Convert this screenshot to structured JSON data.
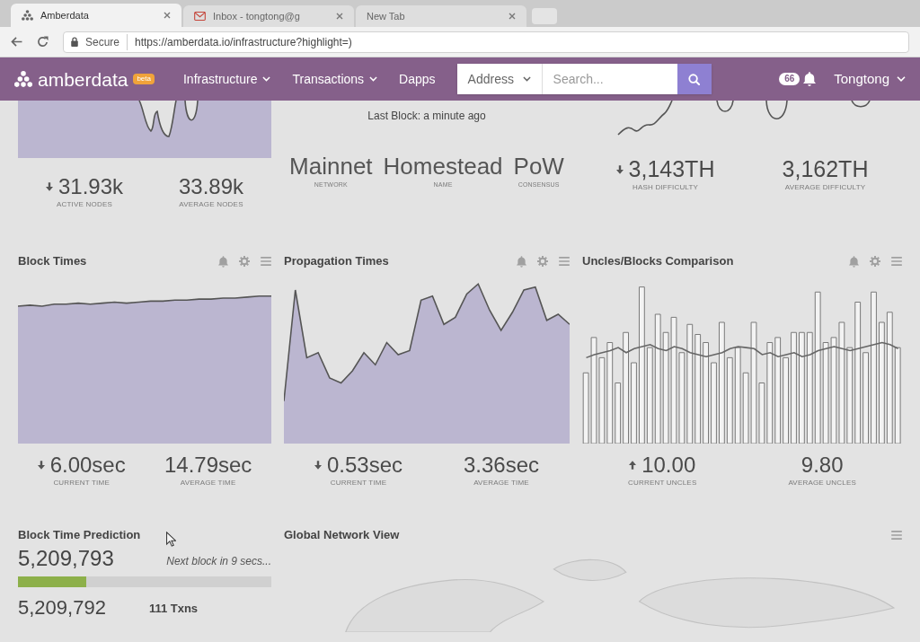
{
  "browser": {
    "tabs": [
      {
        "title": "Amberdata",
        "selected": true
      },
      {
        "title": "Inbox - tongtong@g",
        "selected": false
      },
      {
        "title": "New Tab",
        "selected": false
      }
    ],
    "secure_label": "Secure",
    "url": "https://amberdata.io/infrastructure?highlight=)"
  },
  "header": {
    "logo": "amberdata",
    "badge": "beta",
    "nav": [
      {
        "label": "Infrastructure",
        "dropdown": true
      },
      {
        "label": "Transactions",
        "dropdown": true
      },
      {
        "label": "Dapps",
        "dropdown": false
      }
    ],
    "search": {
      "type": "Address",
      "placeholder": "Search..."
    },
    "notifications": "66",
    "user": "Tongtong"
  },
  "overview": {
    "nodes": [
      {
        "value": "31.93k",
        "label": "ACTIVE NODES",
        "kind": "falling"
      },
      {
        "value": "33.89k",
        "label": "AVERAGE NODES",
        "kind": "plain"
      }
    ],
    "last_block": "Last Block: a minute ago",
    "network": [
      {
        "value": "Mainnet",
        "label": "NETWORK"
      },
      {
        "value": "Homestead",
        "label": "NAME"
      },
      {
        "value": "PoW",
        "label": "CONSENSUS"
      }
    ],
    "difficulty": [
      {
        "value": "3,143TH",
        "label": "HASH DIFFICULTY",
        "kind": "falling"
      },
      {
        "value": "3,162TH",
        "label": "AVERAGE DIFFICULTY",
        "kind": "plain"
      }
    ]
  },
  "panels": [
    {
      "title": "Block Times",
      "kind": "area",
      "stats": [
        {
          "value": "6.00sec",
          "label": "CURRENT TIME",
          "kind": "falling"
        },
        {
          "value": "14.79sec",
          "label": "AVERAGE TIME",
          "kind": "plain"
        }
      ]
    },
    {
      "title": "Propagation Times",
      "kind": "area",
      "stats": [
        {
          "value": "0.53sec",
          "label": "CURRENT TIME",
          "kind": "falling"
        },
        {
          "value": "3.36sec",
          "label": "AVERAGE TIME",
          "kind": "plain"
        }
      ]
    },
    {
      "title": "Uncles/Blocks Comparison",
      "kind": "bars",
      "stats": [
        {
          "value": "10.00",
          "label": "CURRENT UNCLES",
          "kind": "rising"
        },
        {
          "value": "9.80",
          "label": "AVERAGE UNCLES",
          "kind": "plain"
        }
      ]
    }
  ],
  "prediction": {
    "title": "Block Time Prediction",
    "next_block": "5,209,793",
    "countdown": "Next block in 9 secs...",
    "level": 0.27,
    "last_block": "5,209,792",
    "txns": "111 Txns"
  },
  "network_map": {
    "title": "Global Network View"
  }
}
